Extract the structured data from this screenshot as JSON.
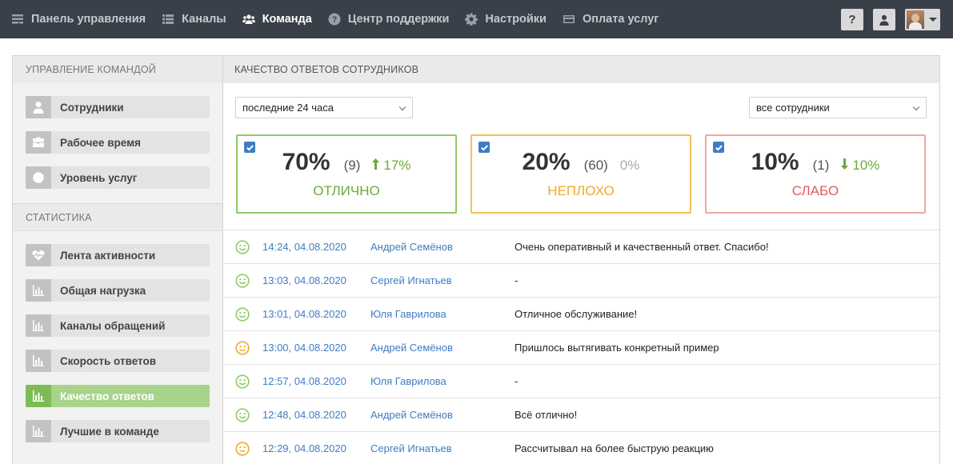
{
  "nav": {
    "items": [
      {
        "label": "Панель управления",
        "icon": "dashboard-icon",
        "active": false
      },
      {
        "label": "Каналы",
        "icon": "list-icon",
        "active": false
      },
      {
        "label": "Команда",
        "icon": "team-icon",
        "active": true
      },
      {
        "label": "Центр поддержки",
        "icon": "question-icon",
        "active": false
      },
      {
        "label": "Настройки",
        "icon": "gear-icon",
        "active": false
      },
      {
        "label": "Оплата услуг",
        "icon": "card-icon",
        "active": false
      }
    ],
    "help_label": "?"
  },
  "sidebar": {
    "team_header": "УПРАВЛЕНИЕ КОМАНДОЙ",
    "team_items": [
      {
        "label": "Сотрудники",
        "icon": "user-icon"
      },
      {
        "label": "Рабочее время",
        "icon": "briefcase-icon"
      },
      {
        "label": "Уровень услуг",
        "icon": "badge-icon"
      }
    ],
    "stats_header": "СТАТИСТИКА",
    "stats_items": [
      {
        "label": "Лента активности",
        "icon": "heartbeat-icon"
      },
      {
        "label": "Общая нагрузка",
        "icon": "bar-chart-icon"
      },
      {
        "label": "Каналы обращений",
        "icon": "bar-chart-icon"
      },
      {
        "label": "Скорость ответов",
        "icon": "bar-chart-icon"
      },
      {
        "label": "Качество ответов",
        "icon": "bar-chart-icon",
        "active": true
      },
      {
        "label": "Лучшие в команде",
        "icon": "bar-chart-icon"
      }
    ]
  },
  "main": {
    "title": "КАЧЕСТВО ОТВЕТОВ СОТРУДНИКОВ",
    "period_select": "последние 24 часа",
    "staff_select": "все сотрудники",
    "cards": [
      {
        "percent": "70%",
        "count": "(9)",
        "change": "17%",
        "change_dir": "up",
        "caption": "ОТЛИЧНО",
        "checked": true
      },
      {
        "percent": "20%",
        "count": "(60)",
        "change": "0%",
        "change_dir": "none",
        "caption": "НЕПЛОХО",
        "checked": true
      },
      {
        "percent": "10%",
        "count": "(1)",
        "change": "10%",
        "change_dir": "down",
        "caption": "СЛАБО",
        "checked": true
      }
    ],
    "feedback": [
      {
        "mood": "good",
        "time": "14:24, 04.08.2020",
        "name": "Андрей Семёнов",
        "message": "Очень оперативный и качественный ответ. Спасибо!"
      },
      {
        "mood": "good",
        "time": "13:03, 04.08.2020",
        "name": "Сергей Игнатьев",
        "message": "-"
      },
      {
        "mood": "good",
        "time": "13:01, 04.08.2020",
        "name": "Юля Гаврилова",
        "message": "Отличное обслуживание!"
      },
      {
        "mood": "ok",
        "time": "13:00, 04.08.2020",
        "name": "Андрей Семёнов",
        "message": "Пришлось вытягивать конкретный пример"
      },
      {
        "mood": "good",
        "time": "12:57, 04.08.2020",
        "name": "Юля Гаврилова",
        "message": "-"
      },
      {
        "mood": "good",
        "time": "12:48, 04.08.2020",
        "name": "Андрей Семёнов",
        "message": "Всё отлично!"
      },
      {
        "mood": "ok",
        "time": "12:29, 04.08.2020",
        "name": "Сергей Игнатьев",
        "message": "Рассчитывал на более быструю реакцию"
      }
    ]
  },
  "colors": {
    "topbar": "#3a4049",
    "good": "#8fcb68",
    "ok": "#f3c05a",
    "bad": "#f2a6a6",
    "link": "#3f7cc4",
    "active_sidebar": "#a8d38a"
  }
}
